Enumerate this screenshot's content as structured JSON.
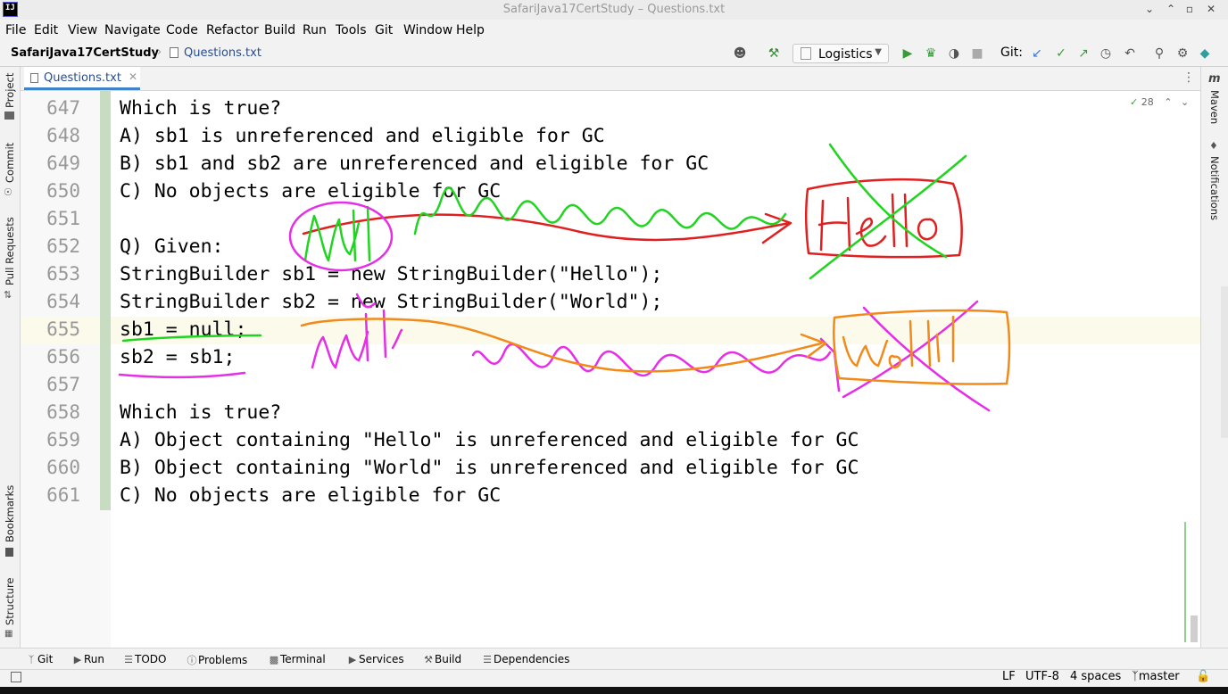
{
  "window": {
    "title": "SafariJava17CertStudy – Questions.txt",
    "logo_text": "IJ"
  },
  "menu": [
    "File",
    "Edit",
    "View",
    "Navigate",
    "Code",
    "Refactor",
    "Build",
    "Run",
    "Tools",
    "Git",
    "Window",
    "Help"
  ],
  "navbar": {
    "project": "SafariJava17CertStudy",
    "file": "Questions.txt",
    "run_config": "Logistics",
    "git_label": "Git:"
  },
  "left_tools": [
    "Project",
    "Commit",
    "Pull Requests",
    "Bookmarks",
    "Structure"
  ],
  "right_tools": [
    "Maven",
    "Notifications"
  ],
  "editor": {
    "tab": "Questions.txt",
    "inspection_count": "28",
    "current_line": "655",
    "lines": [
      {
        "no": "647",
        "text": "Which is true?"
      },
      {
        "no": "648",
        "text": "A) sb1 is unreferenced and eligible for GC"
      },
      {
        "no": "649",
        "text": "B) sb1 and sb2 are unreferenced and eligible for GC"
      },
      {
        "no": "650",
        "text": "C) No objects are eligible for GC"
      },
      {
        "no": "651",
        "text": ""
      },
      {
        "no": "652",
        "text": "Q) Given:"
      },
      {
        "no": "653",
        "text": "StringBuilder sb1 = new StringBuilder(\"Hello\");"
      },
      {
        "no": "654",
        "text": "StringBuilder sb2 = new StringBuilder(\"World\");"
      },
      {
        "no": "655",
        "text": "sb1 = null;"
      },
      {
        "no": "656",
        "text": "sb2 = sb1;"
      },
      {
        "no": "657",
        "text": ""
      },
      {
        "no": "658",
        "text": "Which is true?"
      },
      {
        "no": "659",
        "text": "A) Object containing \"Hello\" is unreferenced and eligible for GC"
      },
      {
        "no": "660",
        "text": "B) Object containing \"World\" is unreferenced and eligible for GC"
      },
      {
        "no": "661",
        "text": "C) No objects are eligible for GC"
      }
    ]
  },
  "bottom_tools": [
    {
      "label": "Git",
      "icon": "git-icon"
    },
    {
      "label": "Run",
      "icon": "run-icon"
    },
    {
      "label": "TODO",
      "icon": "todo-icon"
    },
    {
      "label": "Problems",
      "icon": "problems-icon"
    },
    {
      "label": "Terminal",
      "icon": "terminal-icon"
    },
    {
      "label": "Services",
      "icon": "services-icon"
    },
    {
      "label": "Build",
      "icon": "build-icon"
    },
    {
      "label": "Dependencies",
      "icon": "dependencies-icon"
    }
  ],
  "status": {
    "line_sep": "LF",
    "encoding": "UTF-8",
    "indent": "4 spaces",
    "branch": "master"
  },
  "annotation_colors": {
    "red": "#e02020",
    "green": "#22d422",
    "magenta": "#e52ee5",
    "orange": "#f28a1a"
  }
}
